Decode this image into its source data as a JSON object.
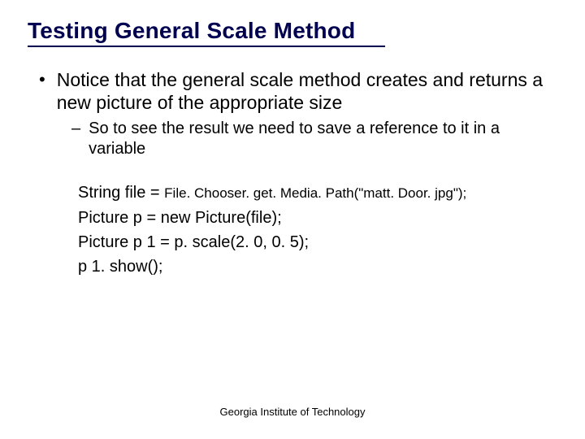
{
  "slide": {
    "title": "Testing General Scale Method",
    "bullet_main": "Notice that the general scale method creates and returns a new picture of the appropriate size",
    "bullet_sub": "So to see the result we need to save a reference to it in a variable",
    "code": {
      "line1_prefix": "String file = ",
      "line1_call": "File. Chooser. get. Media. Path(\"matt. Door. jpg\");",
      "line2": "Picture p = new Picture(file);",
      "line3": "Picture p 1 = p. scale(2. 0, 0. 5);",
      "line4": "p 1. show();"
    },
    "footer": "Georgia Institute of Technology"
  }
}
